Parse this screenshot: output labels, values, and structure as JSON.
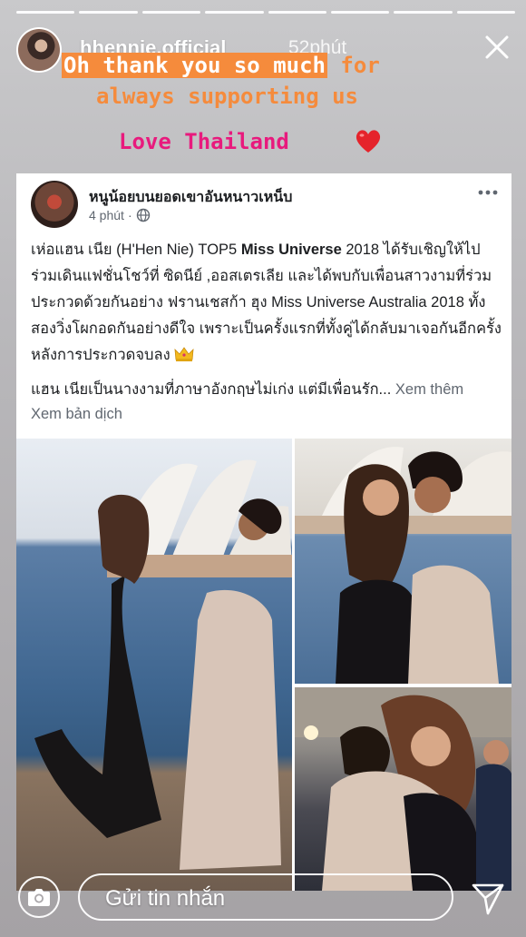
{
  "story": {
    "segments": 8,
    "username": "hhennie.official",
    "time_ago": "52phút",
    "caption_line1_highlight": "Oh thank you so much",
    "caption_line1_rest": " for",
    "caption_line2": "always supporting us",
    "caption_line3": "Love Thailand",
    "caption_colors": {
      "orange": "#f58b3c",
      "pink": "#e81a7d"
    }
  },
  "post": {
    "page_name": "หนูน้อยบนยอดเขาอันหนาวเหน็บ",
    "time": "4 phút",
    "body_parts": [
      "เห่อแฮน เนีย (H'Hen Nie) TOP5 ",
      "Miss Universe",
      " 2018 ได้รับเชิญให้ไปร่วมเดินแฟชั่นโชว์ที่ ซิดนีย์ ,ออสเตรเลีย และได้พบกับเพื่อนสาวงามที่ร่วมประกวดด้วยกันอย่าง ฟรานเชสก้า ฮุง Miss Universe Australia 2018 ทั้งสองวิ่งโผกอดกันอย่างดีใจ เพราะเป็นครั้งแรกที่ทั้งคู่ได้กลับมาเจอกันอีกครั้งหลังการประกวดจบลง"
    ],
    "para2": "แฮน เนียเป็นนางงามที่ภาษาอังกฤษไม่เก่ง แต่มีเพื่อนรัก...",
    "see_more": "Xem thêm",
    "translate": "Xem bản dịch"
  },
  "reply": {
    "placeholder": "Gửi tin nhắn"
  },
  "icons": {
    "close": "close-icon",
    "heart": "heart-icon",
    "globe": "globe-icon",
    "more": "more-icon",
    "crown": "crown-icon",
    "camera": "camera-icon",
    "send": "send-icon"
  }
}
